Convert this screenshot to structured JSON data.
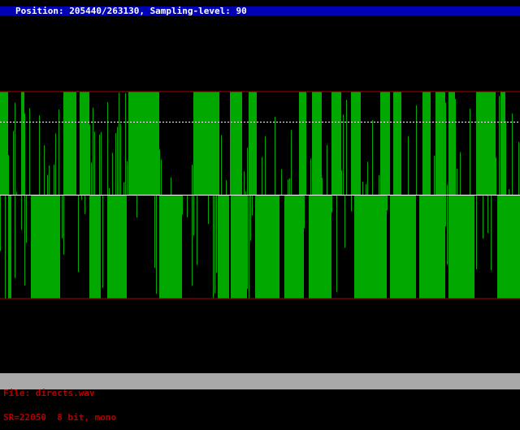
{
  "header": {
    "position_label": "Position:",
    "position_current": "205440",
    "position_total": "263130",
    "sampling_label": "Sampling-level:",
    "sampling_value": "90",
    "text": "Position: 205440/263130, Sampling-level: 90"
  },
  "status": {
    "file_line": "File: directs.wav",
    "format_line": "SR=22050  8 bit, mono"
  },
  "colors": {
    "background": "#000000",
    "header_bar": "#0000b4",
    "header_text": "#ffffff",
    "waveform": "#00a800",
    "boundary_lines": "#a80000",
    "center_line": "#ffffff",
    "level_line": "#ffffff",
    "status_bar": "#a8a8a8",
    "status_text": "#b40000"
  },
  "waveform": {
    "channels": "mono",
    "bit_depth": 8,
    "sample_rate": 22050,
    "sampling_level": 90,
    "position": 205440,
    "total_samples": 263130
  }
}
